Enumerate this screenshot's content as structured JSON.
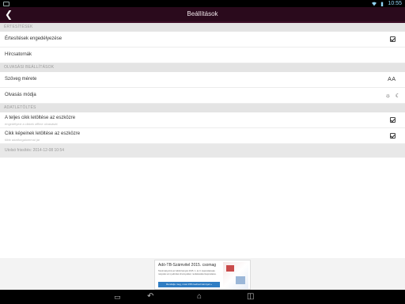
{
  "status_bar": {
    "time": "10:55"
  },
  "app_bar": {
    "title": "Beállítások"
  },
  "sections": [
    {
      "header": "ÉRTESÍTÉSEK"
    },
    {
      "header": "OLVASÁSI BEÁLLÍTÁSOK"
    },
    {
      "header": "ADATLETÖLTÉS"
    }
  ],
  "notifications": {
    "enable_label": "Értesítések engedélyezése",
    "enable_checked": true,
    "channels_label": "Hírcsatornák"
  },
  "reading": {
    "text_size_label": "Szöveg mérete",
    "mode_label": "Olvasás módja"
  },
  "download": {
    "full_article_label": "A teljes cikk letöltése az eszközre",
    "full_article_sub": "engedélyezi a cikkek offline olvasását",
    "full_article_checked": true,
    "images_label": "Cikk képeinek letöltése az eszközre",
    "images_sub": "több adatforgalommal jár",
    "images_checked": true
  },
  "last_update": "Utolsó frissítés:   2014-12-08 10:54",
  "ad": {
    "title": "Adó-TB-Számvitel 2015. csomag",
    "text": "Tanulmányozza az Adótörvények 2015. 1. és II. kapcsolatosak, melyeket az új adózási törvényekkel, rendeletekkel kapcsolatos.",
    "button": "Rendelje meg, most 15% kedvezménnyel »"
  }
}
